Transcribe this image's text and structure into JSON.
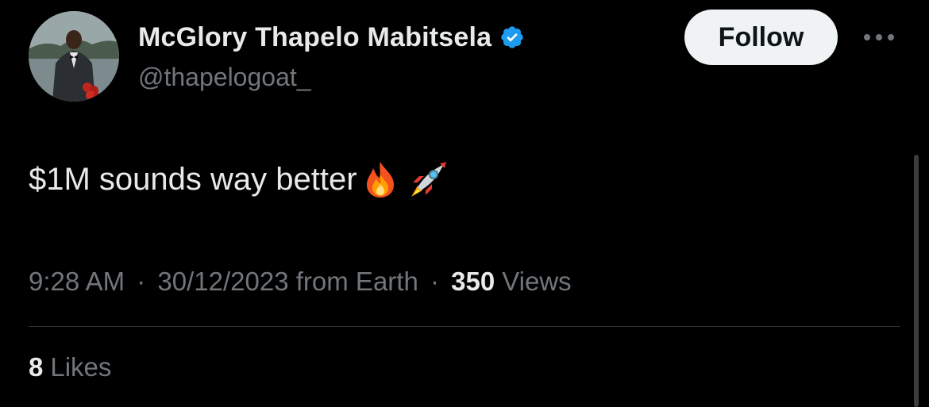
{
  "author": {
    "display_name": "McGlory Thapelo Mabitsela",
    "handle": "@thapelogoat_",
    "verified": true,
    "verified_color": "#1d9bf0"
  },
  "actions": {
    "follow_label": "Follow",
    "more_icon": "more-horizontal-icon"
  },
  "tweet": {
    "text": "$1M sounds way better",
    "emojis": [
      "fire-emoji",
      "rocket-emoji"
    ]
  },
  "meta": {
    "time": "9:28 AM",
    "separator": "·",
    "date": "30/12/2023",
    "source": "from Earth",
    "views_count": "350",
    "views_label": "Views"
  },
  "engagement": {
    "likes_count": "8",
    "likes_label": "Likes"
  },
  "colors": {
    "background": "#000000",
    "primary_text": "#e7e9ea",
    "secondary_text": "#71767b",
    "follow_bg": "#eff3f4",
    "divider": "#2f3336"
  }
}
